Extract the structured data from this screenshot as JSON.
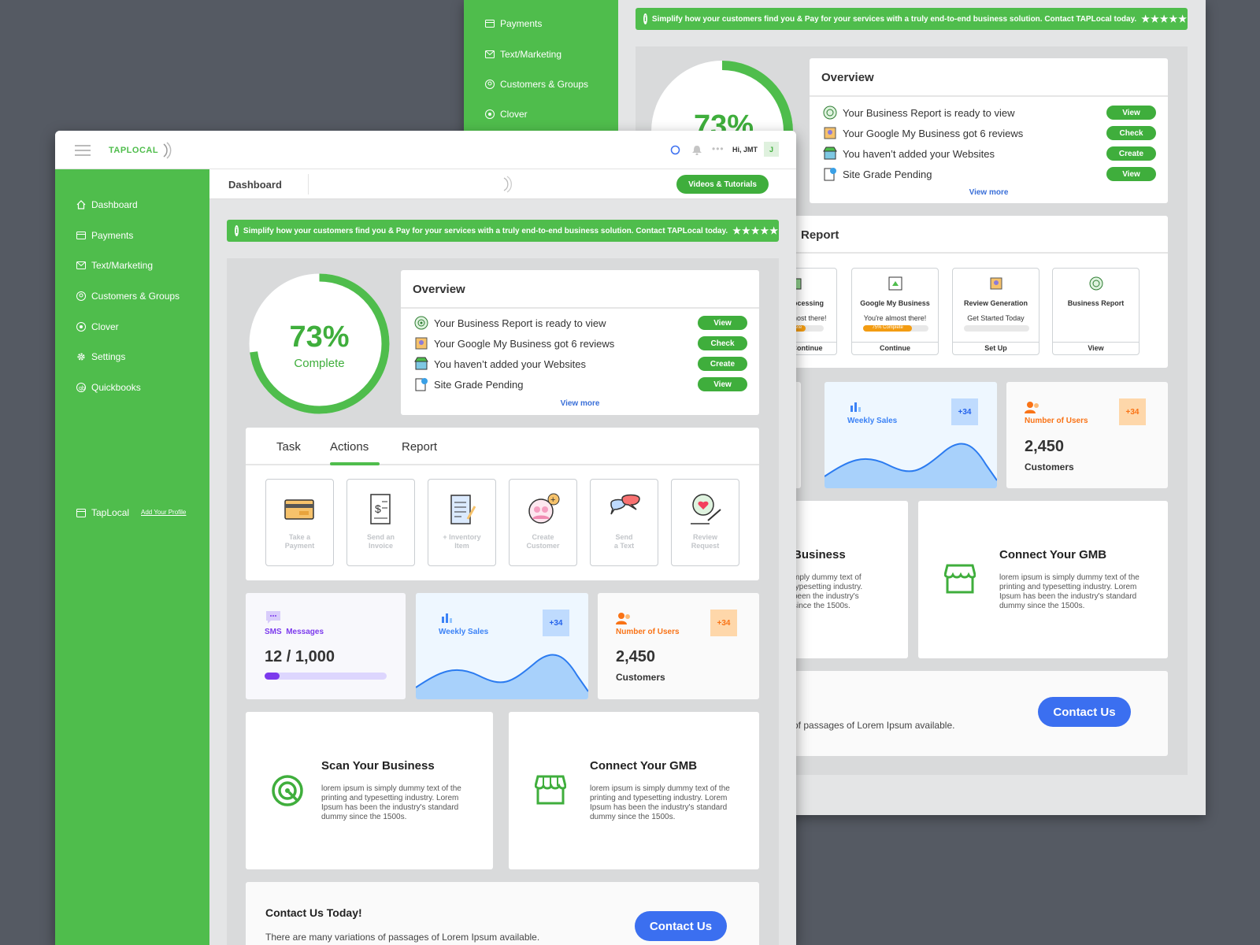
{
  "brand": {
    "logo_text": "TAPLOCAL",
    "green": "#4fbd4c",
    "blue": "#3b6ff0"
  },
  "topbar": {
    "greeting": "Hi, JMT",
    "avatar": "J",
    "icons": [
      "menu-icon",
      "search-icon",
      "bell-icon",
      "more-icon"
    ]
  },
  "sidebar": {
    "items": [
      {
        "label": "Dashboard",
        "icon": "home-icon"
      },
      {
        "label": "Payments",
        "icon": "card-icon"
      },
      {
        "label": "Text/Marketing",
        "icon": "mail-icon"
      },
      {
        "label": "Customers & Groups",
        "icon": "user-circle-icon"
      },
      {
        "label": "Clover",
        "icon": "clover-icon"
      },
      {
        "label": "Settings",
        "icon": "gear-icon"
      },
      {
        "label": "Quickbooks",
        "icon": "quickbooks-icon"
      }
    ],
    "profile": {
      "label": "TapLocal",
      "link": "Add Your Profile"
    }
  },
  "header": {
    "title": "Dashboard",
    "videos_button": "Videos & Tutorials"
  },
  "banner": {
    "text": "Simplify how your customers find you & Pay for your services with a truly end-to-end business solution. Contact TAPLocal today.",
    "stars": "★★★★★"
  },
  "progress": {
    "percent_label": "73%",
    "sub": "Complete",
    "value": 0.73
  },
  "overview": {
    "title": "Overview",
    "items": [
      {
        "text": "Your Business Report is ready to view",
        "button": "View"
      },
      {
        "text": "Your Google My Business got 6 reviews",
        "button": "Check"
      },
      {
        "text": "You haven’t added your Websites",
        "button": "Create"
      },
      {
        "text": "Site Grade Pending",
        "button": "View"
      }
    ],
    "view_more": "View more"
  },
  "tabs": {
    "items": [
      "Task",
      "Actions",
      "Report"
    ],
    "active": "Actions"
  },
  "actions": [
    {
      "label": "Take a\nPayment"
    },
    {
      "label": "Send an\nInvoice"
    },
    {
      "label": "+ Inventory\nItem"
    },
    {
      "label": "Create\nCustomer"
    },
    {
      "label": "Send\na Text"
    },
    {
      "label": "Review\nRequest"
    }
  ],
  "stats": {
    "sms": {
      "label": "SMS  Messages",
      "value": "12 / 1,000",
      "progress": 0.12
    },
    "sales": {
      "label": "Weekly Sales",
      "badge": "+34"
    },
    "users": {
      "label": "Number of Users",
      "badge": "+34",
      "value": "2,450",
      "sub": "Customers"
    }
  },
  "promos": {
    "scan": {
      "title": "Scan Your Business",
      "text": "lorem ipsum is simply dummy text of the printing and typesetting industry. Lorem Ipsum has been the industry's standard dummy since the 1500s."
    },
    "gmb": {
      "title": "Connect Your GMB",
      "text": "lorem ipsum is simply dummy text of the printing and typesetting industry. Lorem Ipsum has been the industry's standard dummy since the 1500s."
    }
  },
  "contact": {
    "title": "Contact Us Today!",
    "text": "There are many variations of passages of Lorem Ipsum available.",
    "button": "Contact Us"
  },
  "back": {
    "report_title": "Report",
    "report_cards": [
      {
        "title": "e Processing",
        "sub": "e almost there!",
        "bar": "Complete",
        "foot": "Continue"
      },
      {
        "title": "Google My Business",
        "sub": "You're almost there!",
        "bar": "75% Complete",
        "foot": "Continue"
      },
      {
        "title": "Review Generation",
        "sub": "Get Started Today",
        "bar": "",
        "foot": "Set Up"
      },
      {
        "title": "Business Report",
        "sub": "",
        "bar": "",
        "foot": "View"
      }
    ],
    "scan_title_partial": "Business",
    "scan_text_partial": "mply dummy text of\ntypesetting industry.\n been the industry's\n since the 1500s.",
    "contact_text_partial": "of passages of Lorem Ipsum available."
  }
}
